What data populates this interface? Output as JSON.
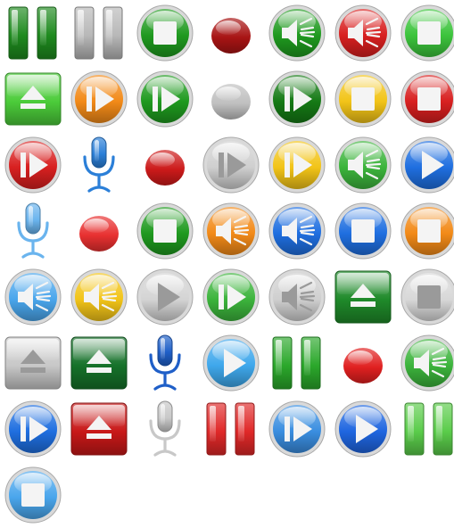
{
  "icons": [
    {
      "name": "pause-icon",
      "style": "pause-bars",
      "color": "#1e8a1e"
    },
    {
      "name": "pause-icon",
      "style": "pause-bars",
      "color": "#b8b8b8"
    },
    {
      "name": "stop-icon",
      "style": "round",
      "color": "#1f9a1f"
    },
    {
      "name": "record-icon",
      "style": "dot",
      "color": "#a81414"
    },
    {
      "name": "volume-icon",
      "style": "round",
      "color": "#1f9a1f"
    },
    {
      "name": "volume-icon",
      "style": "round",
      "color": "#d82020"
    },
    {
      "name": "stop-icon",
      "style": "round",
      "color": "#3cc43c"
    },
    {
      "name": "eject-icon",
      "style": "square",
      "color": "#4ccc3a"
    },
    {
      "name": "next-icon",
      "style": "round",
      "color": "#f28a18"
    },
    {
      "name": "next-icon",
      "style": "round",
      "color": "#1f9a1f"
    },
    {
      "name": "record-icon",
      "style": "dot",
      "color": "#c0c0c0"
    },
    {
      "name": "next-icon",
      "style": "round",
      "color": "#157a15"
    },
    {
      "name": "stop-icon",
      "style": "round",
      "color": "#f2c418"
    },
    {
      "name": "stop-icon",
      "style": "round",
      "color": "#d82020"
    },
    {
      "name": "next-icon",
      "style": "round",
      "color": "#d82020"
    },
    {
      "name": "microphone-icon",
      "style": "mic",
      "color": "#2b7fd8"
    },
    {
      "name": "record-icon",
      "style": "dot",
      "color": "#cc1a1a"
    },
    {
      "name": "next-icon",
      "style": "round",
      "color": "#cfcfcf"
    },
    {
      "name": "next-icon",
      "style": "round",
      "color": "#f2c418"
    },
    {
      "name": "volume-icon",
      "style": "round",
      "color": "#3cb43c"
    },
    {
      "name": "play-icon",
      "style": "round",
      "color": "#1f6fe0"
    },
    {
      "name": "microphone-icon",
      "style": "mic",
      "color": "#6ab4ee"
    },
    {
      "name": "record-icon",
      "style": "dot",
      "color": "#e83030"
    },
    {
      "name": "stop-icon",
      "style": "round",
      "color": "#1f9a1f"
    },
    {
      "name": "volume-icon",
      "style": "round",
      "color": "#f28a18"
    },
    {
      "name": "volume-icon",
      "style": "round",
      "color": "#1f6fe0"
    },
    {
      "name": "stop-icon",
      "style": "round",
      "color": "#1f6fe0"
    },
    {
      "name": "stop-icon",
      "style": "round",
      "color": "#f28a18"
    },
    {
      "name": "volume-icon",
      "style": "round",
      "color": "#4aa6ec"
    },
    {
      "name": "volume-icon",
      "style": "round",
      "color": "#f2c418"
    },
    {
      "name": "play-icon",
      "style": "round",
      "color": "#d4d4d4"
    },
    {
      "name": "next-icon",
      "style": "round",
      "color": "#3cb43c"
    },
    {
      "name": "volume-icon",
      "style": "round",
      "color": "#cfcfcf"
    },
    {
      "name": "eject-icon",
      "style": "square",
      "color": "#1f8a2a"
    },
    {
      "name": "stop-icon",
      "style": "round",
      "color": "#d8d8d8"
    },
    {
      "name": "eject-icon",
      "style": "square",
      "color": "#c8c8c8"
    },
    {
      "name": "eject-icon",
      "style": "square",
      "color": "#16722a"
    },
    {
      "name": "microphone-icon",
      "style": "mic",
      "color": "#1f5fc8"
    },
    {
      "name": "play-icon",
      "style": "round",
      "color": "#3fa8ec"
    },
    {
      "name": "pause-icon",
      "style": "pause-bars",
      "color": "#2ba82b"
    },
    {
      "name": "record-icon",
      "style": "dot",
      "color": "#e02020"
    },
    {
      "name": "volume-icon",
      "style": "round",
      "color": "#3cb43c"
    },
    {
      "name": "next-icon",
      "style": "round",
      "color": "#1f6fe0"
    },
    {
      "name": "eject-icon",
      "style": "square",
      "color": "#c81818"
    },
    {
      "name": "microphone-icon",
      "style": "mic",
      "color": "#c8c8c8"
    },
    {
      "name": "pause-icon",
      "style": "pause-bars",
      "color": "#e02828"
    },
    {
      "name": "next-icon",
      "style": "round",
      "color": "#3a8ee0"
    },
    {
      "name": "play-icon",
      "style": "round",
      "color": "#1f66e0"
    },
    {
      "name": "pause-icon",
      "style": "pause-bars",
      "color": "#5acc4a"
    },
    {
      "name": "stop-icon",
      "style": "round",
      "color": "#4aa6ec"
    }
  ]
}
